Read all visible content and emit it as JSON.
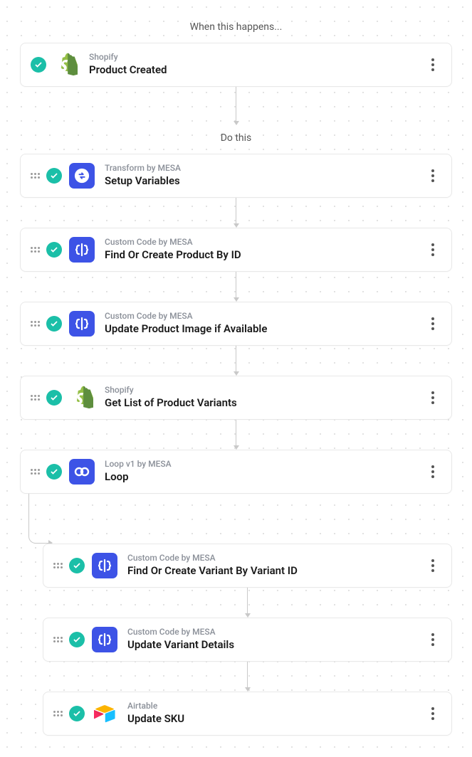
{
  "labels": {
    "trigger_section": "When this happens...",
    "actions_section": "Do this"
  },
  "trigger": {
    "app": "Shopify",
    "title": "Product Created",
    "icon": "shopify"
  },
  "steps": [
    {
      "app": "Transform by MESA",
      "title": "Setup Variables",
      "icon": "transform",
      "indent": 0
    },
    {
      "app": "Custom Code by MESA",
      "title": "Find Or Create Product By ID",
      "icon": "code",
      "indent": 0
    },
    {
      "app": "Custom Code by MESA",
      "title": "Update Product Image if Available",
      "icon": "code",
      "indent": 0
    },
    {
      "app": "Shopify",
      "title": "Get List of Product Variants",
      "icon": "shopify",
      "indent": 0
    },
    {
      "app": "Loop v1 by MESA",
      "title": "Loop",
      "icon": "loop",
      "indent": 0
    },
    {
      "app": "Custom Code by MESA",
      "title": "Find Or Create Variant By Variant ID",
      "icon": "code",
      "indent": 1
    },
    {
      "app": "Custom Code by MESA",
      "title": "Update Variant Details",
      "icon": "code",
      "indent": 1
    },
    {
      "app": "Airtable",
      "title": "Update SKU",
      "icon": "airtable",
      "indent": 1
    }
  ]
}
